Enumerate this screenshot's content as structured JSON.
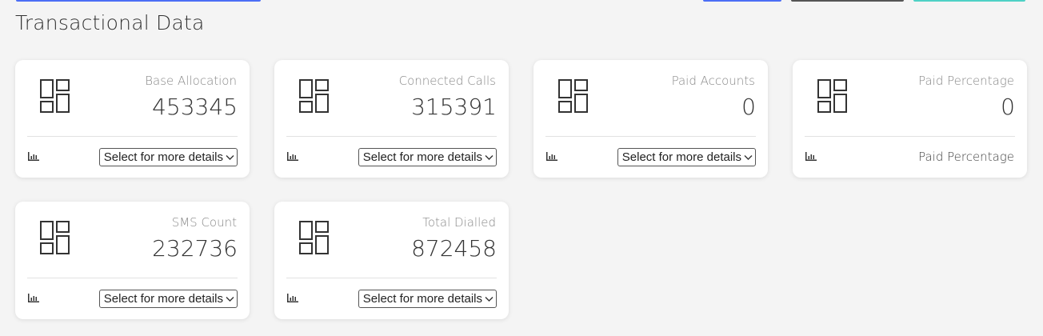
{
  "page": {
    "title": "Transactional Data"
  },
  "colors": {
    "accent_blue": "#4c6ef5",
    "accent_teal": "#4fd1c5",
    "accent_dark": "#555555",
    "icon": "#333333"
  },
  "icons": {
    "kpi": "dashboard-layout-icon",
    "chart": "bar-chart-icon",
    "dropdown": "chevron-down-icon"
  },
  "cards": [
    {
      "label": "Base Allocation",
      "value": "453345",
      "detail": "Select for more details",
      "detail_type": "select"
    },
    {
      "label": "Connected Calls",
      "value": "315391",
      "detail": "Select for more details",
      "detail_type": "select"
    },
    {
      "label": "Paid Accounts",
      "value": "0",
      "detail": "Select for more details",
      "detail_type": "select"
    },
    {
      "label": "Paid Percentage",
      "value": "0",
      "detail": "Paid Percentage",
      "detail_type": "text"
    },
    {
      "label": "SMS Count",
      "value": "232736",
      "detail": "Select for more details",
      "detail_type": "select"
    },
    {
      "label": "Total Dialled",
      "value": "872458",
      "detail": "Select for more details",
      "detail_type": "select"
    }
  ]
}
